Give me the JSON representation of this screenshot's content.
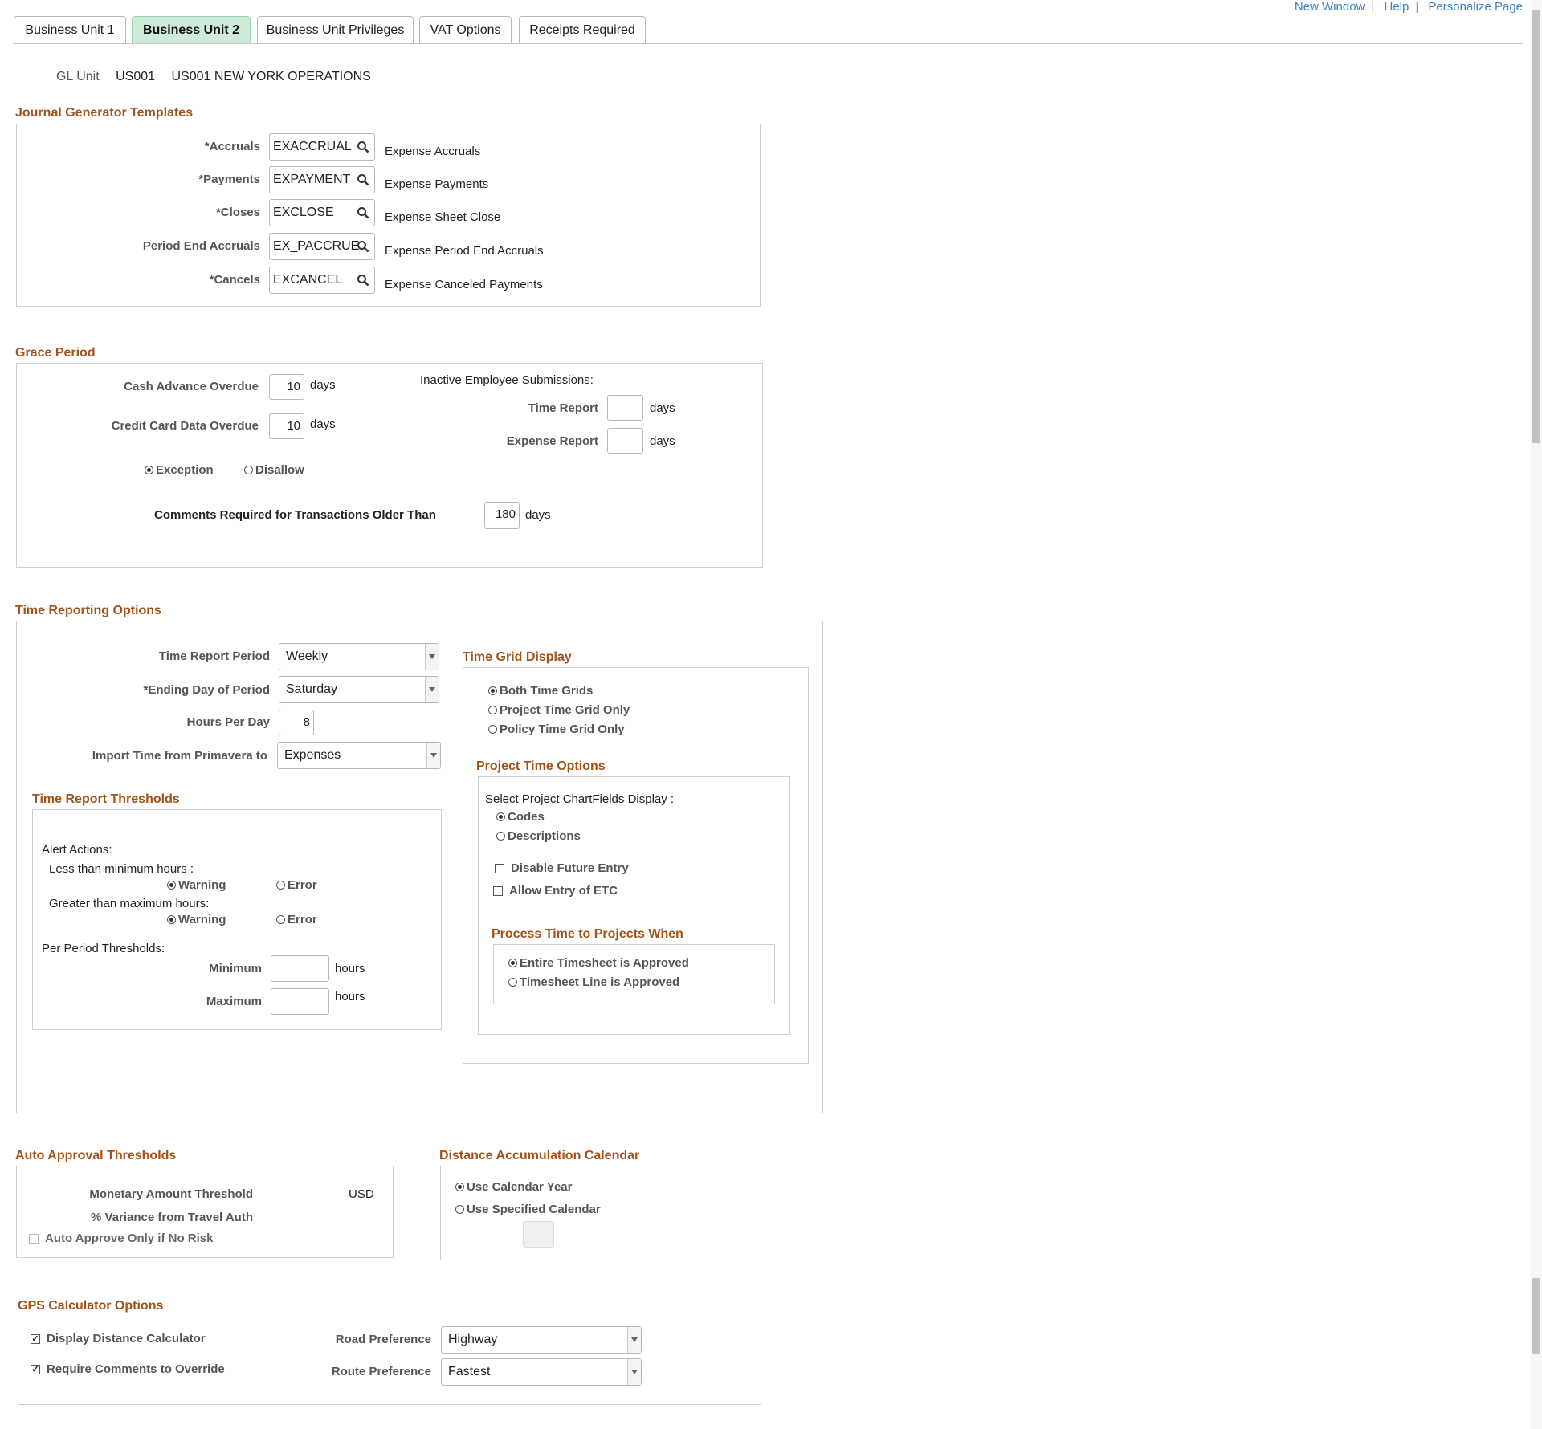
{
  "tabs": [
    {
      "label": "Business Unit 1",
      "active": false
    },
    {
      "label": "Business Unit 2",
      "active": true
    },
    {
      "label": "Business Unit Privileges",
      "active": false
    },
    {
      "label": "VAT Options",
      "active": false
    },
    {
      "label": "Receipts Required",
      "active": false
    }
  ],
  "top_links": {
    "new_window": "New Window",
    "help": "Help",
    "personalize": "Personalize Page"
  },
  "gl_unit": {
    "label": "GL Unit",
    "code": "US001",
    "name": "US001 NEW YORK OPERATIONS"
  },
  "journal_templates": {
    "title": "Journal Generator Templates",
    "rows": [
      {
        "label": "*Accruals",
        "value": "EXACCRUAL",
        "desc": "Expense Accruals"
      },
      {
        "label": "*Payments",
        "value": "EXPAYMENT",
        "desc": "Expense Payments"
      },
      {
        "label": "*Closes",
        "value": "EXCLOSE",
        "desc": "Expense Sheet Close"
      },
      {
        "label": "Period End Accruals",
        "value": "EX_PACCRUE",
        "desc": "Expense Period End Accruals"
      },
      {
        "label": "*Cancels",
        "value": "EXCANCEL",
        "desc": "Expense Canceled Payments"
      }
    ]
  },
  "grace_period": {
    "title": "Grace Period",
    "cash_advance_label": "Cash Advance Overdue",
    "cash_advance_value": "10",
    "credit_card_label": "Credit Card Data Overdue",
    "credit_card_value": "10",
    "days": "days",
    "inactive_label": "Inactive Employee Submissions:",
    "time_report_label": "Time Report",
    "time_report_value": "",
    "expense_report_label": "Expense Report",
    "expense_report_value": "",
    "exception_label": "Exception",
    "disallow_label": "Disallow",
    "selected": "Exception",
    "comments_label": "Comments Required for Transactions Older Than",
    "comments_value": "180"
  },
  "time_reporting": {
    "title": "Time Reporting Options",
    "period_label": "Time Report Period",
    "period_value": "Weekly",
    "ending_label": "*Ending Day of Period",
    "ending_value": "Saturday",
    "hours_label": "Hours Per Day",
    "hours_value": "8",
    "import_label": "Import Time from Primavera to",
    "import_value": "Expenses",
    "thresholds": {
      "title": "Time Report Thresholds",
      "alert_actions": "Alert Actions:",
      "less_label": "Less than minimum hours :",
      "greater_label": "Greater than maximum hours:",
      "warning": "Warning",
      "error": "Error",
      "per_period": "Per Period Thresholds:",
      "minimum": "Minimum",
      "maximum": "Maximum",
      "hours": "hours",
      "min_value": "",
      "max_value": ""
    },
    "grid_display": {
      "title": "Time Grid Display",
      "options": [
        "Both Time Grids",
        "Project Time Grid Only",
        "Policy Time Grid Only"
      ],
      "selected": "Both Time Grids"
    },
    "project_options": {
      "title": "Project Time Options",
      "chartfields_label": "Select Project ChartFields Display :",
      "codes": "Codes",
      "descriptions": "Descriptions",
      "selected": "Codes",
      "disable_future": "Disable Future Entry",
      "allow_etc": "Allow Entry of ETC"
    },
    "process_when": {
      "title": "Process Time to Projects When",
      "options": [
        "Entire Timesheet is Approved",
        "Timesheet Line is Approved"
      ],
      "selected": "Entire Timesheet is Approved"
    }
  },
  "auto_approval": {
    "title": "Auto Approval Thresholds",
    "monetary_label": "Monetary Amount Threshold",
    "currency": "USD",
    "variance_label": "% Variance from Travel Auth",
    "no_risk_label": "Auto Approve Only if No Risk"
  },
  "distance_calendar": {
    "title": "Distance Accumulation Calendar",
    "options": [
      "Use Calendar Year",
      "Use Specified Calendar"
    ],
    "selected": "Use Calendar Year",
    "calendar_value": ""
  },
  "gps": {
    "title": "GPS Calculator Options",
    "display_label": "Display Distance Calculator",
    "require_label": "Require Comments to Override",
    "road_label": "Road Preference",
    "road_value": "Highway",
    "route_label": "Route Preference",
    "route_value": "Fastest"
  }
}
